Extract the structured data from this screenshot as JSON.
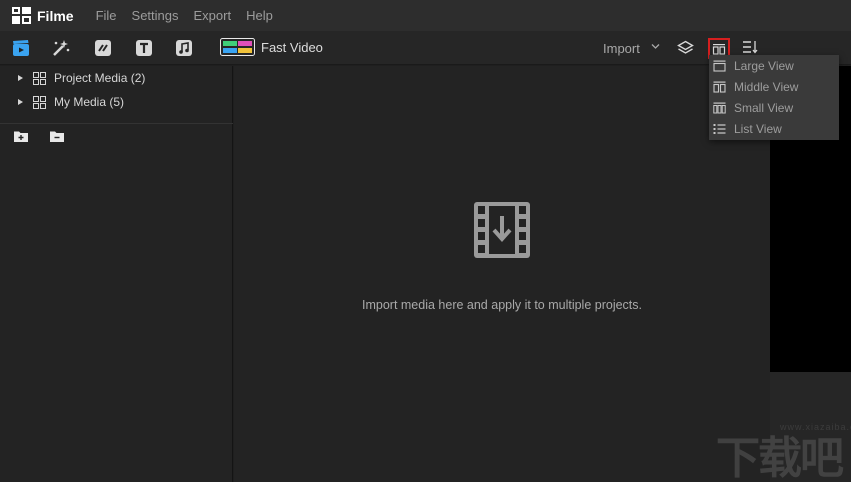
{
  "app": {
    "name": "Filme"
  },
  "menu": [
    "File",
    "Settings",
    "Export",
    "Help"
  ],
  "toolbar": {
    "tools": [
      {
        "name": "media-tool",
        "icon": "media-clapper-icon",
        "color": "#3aa3f0"
      },
      {
        "name": "effects-tool",
        "icon": "magic-wand-icon",
        "color": "#d8d8d8"
      },
      {
        "name": "transitions-tool",
        "icon": "transition-icon",
        "color": "#d8d8d8"
      },
      {
        "name": "text-tool",
        "icon": "text-icon",
        "color": "#d8d8d8"
      },
      {
        "name": "audio-tool",
        "icon": "music-note-icon",
        "color": "#d8d8d8"
      }
    ],
    "fast_video_label": "Fast Video",
    "import_label": "Import"
  },
  "library": {
    "items": [
      {
        "label": "Project Media (2)"
      },
      {
        "label": "My Media (5)"
      }
    ]
  },
  "main": {
    "empty_message": "Import media here and apply it to multiple projects."
  },
  "view_menu": {
    "items": [
      {
        "label": "Large View",
        "icon": "large-view-icon"
      },
      {
        "label": "Middle View",
        "icon": "middle-view-icon"
      },
      {
        "label": "Small View",
        "icon": "small-view-icon"
      },
      {
        "label": "List View",
        "icon": "list-view-icon"
      }
    ]
  },
  "watermark": {
    "text": "下载吧",
    "subtext": "www.xiazaiba.com"
  },
  "colors": {
    "accent": "#3aa3f0",
    "highlight_border": "#d61f1f",
    "background": "#1f1f1f"
  }
}
